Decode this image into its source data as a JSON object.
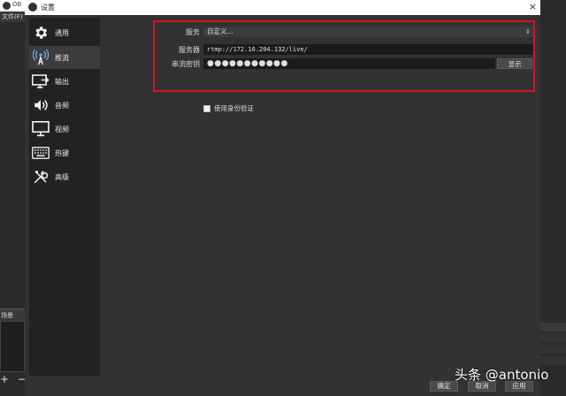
{
  "background_window": {
    "title": "OB",
    "menu_file": "文件(F)",
    "scenes_header": "场景",
    "add_remove": "+ −",
    "right_panel_items": [
      "",
      "",
      "",
      "",
      ""
    ],
    "right_bits": [
      "",
      "",
      ""
    ]
  },
  "dialog": {
    "title": "设置",
    "close_icon": "×",
    "sidebar": {
      "items": [
        {
          "label": "通用",
          "icon": "gear-icon"
        },
        {
          "label": "推流",
          "icon": "antenna-icon",
          "active": true
        },
        {
          "label": "输出",
          "icon": "output-icon"
        },
        {
          "label": "音频",
          "icon": "speaker-icon"
        },
        {
          "label": "视频",
          "icon": "monitor-icon"
        },
        {
          "label": "热键",
          "icon": "keyboard-icon"
        },
        {
          "label": "高级",
          "icon": "tools-icon"
        }
      ]
    },
    "stream": {
      "service_label": "服务",
      "service_value": "自定义...",
      "server_label": "服务器",
      "server_value": "rtmp://172.16.204.132/live/",
      "key_label": "串流密钥",
      "key_value": "●●●●●●●●●●●",
      "show_button": "显示",
      "auth_checkbox_label": "使用身份验证",
      "auth_checked": false
    },
    "footer": {
      "ok": "确定",
      "cancel": "取消",
      "apply": "应用"
    },
    "highlight_color": "#d21a1a"
  },
  "watermark": "头条 @antonio"
}
